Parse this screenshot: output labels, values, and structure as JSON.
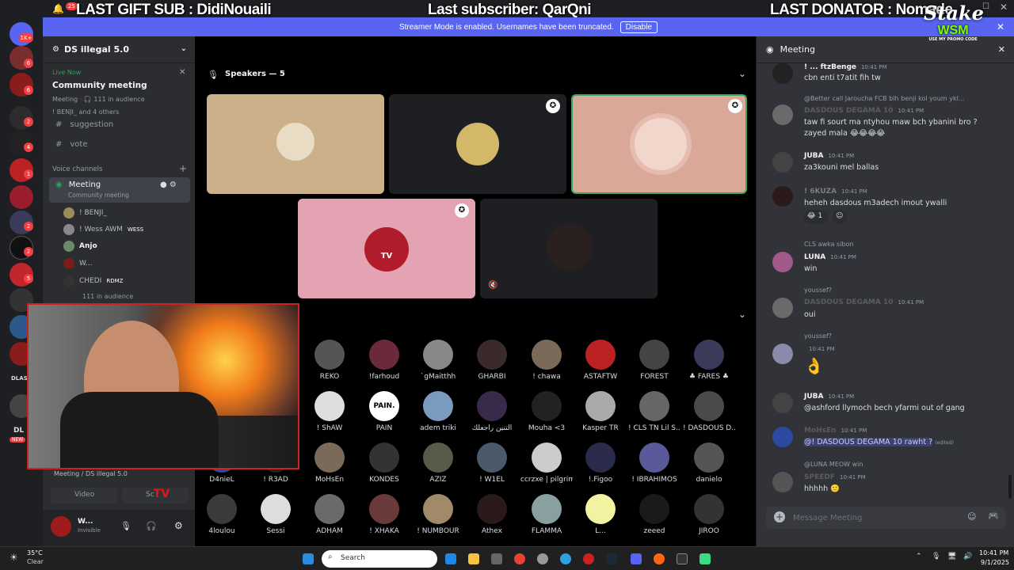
{
  "overlay": {
    "last_gift": "LAST GIFT SUB : DidiNouaili",
    "last_sub": "Last subscriber: QarQni",
    "last_donator": "LAST DONATOR : Nomade",
    "bell_count": "25",
    "stake_logo": "Stake",
    "wsm": "WSM",
    "promo": "USE MY PROMO CODE"
  },
  "streamer_bar": {
    "text": "Streamer Mode is enabled. Usernames have been truncated.",
    "disable": "Disable"
  },
  "rail": {
    "top_badge": "1K+",
    "badges": [
      "6",
      "6",
      "2",
      "4",
      "1",
      "2",
      "2",
      "5",
      "2"
    ],
    "dlas": "DLAS",
    "dl": "DL",
    "new": "NEW"
  },
  "sidebar": {
    "server_name": "DS illegal 5.0",
    "live_now": "Live Now",
    "event_title": "Community meeting",
    "event_meta": "Meeting · 🎧 111 in audience",
    "event_people": "! BENJI_ and 4 others",
    "channels": [
      "suggestion",
      "vote"
    ],
    "voice_header": "Voice channels",
    "voice_channel": "Meeting",
    "voice_sub": "Community meeting",
    "users": [
      {
        "name": "! BENJI_",
        "tag": ""
      },
      {
        "name": "! Wess AWM",
        "tag": "WESS"
      },
      {
        "name": "Anjo",
        "tag": ""
      },
      {
        "name": "W...",
        "tag": ""
      },
      {
        "name": "CHEDI",
        "tag": "RDMZ"
      }
    ],
    "audience": "111 in audience",
    "status_channel": "Meeting / DS illegal 5.0",
    "video_btn": "Video",
    "screen_btn": "Sc",
    "me_name": "W...",
    "me_status": "Invisible"
  },
  "stage": {
    "speakers_label": "Speakers — 5",
    "audience": [
      {
        "name": "REKO"
      },
      {
        "name": "!farhoud"
      },
      {
        "name": "`gMaitthh"
      },
      {
        "name": "GHARBI"
      },
      {
        "name": "! chawa"
      },
      {
        "name": "ASTAFTW"
      },
      {
        "name": "FOREST"
      },
      {
        "name": "♣ FARES ♣"
      },
      {
        "name": "! ShAW"
      },
      {
        "name": "PAIN"
      },
      {
        "name": "adem triki"
      },
      {
        "name": "التنين راجعلك"
      },
      {
        "name": "Mouha <3"
      },
      {
        "name": "Kasper TR"
      },
      {
        "name": "! CLS TN Lil S..."
      },
      {
        "name": "! DASDOUS D..."
      },
      {
        "name": "D4nieL"
      },
      {
        "name": "! R3AD"
      },
      {
        "name": "MoHsEn"
      },
      {
        "name": "KONDES"
      },
      {
        "name": "AZIZ"
      },
      {
        "name": "! W1EL"
      },
      {
        "name": "ccrzxe | pilgrim"
      },
      {
        "name": "!.Figoo"
      },
      {
        "name": "! IBRAHIMOS"
      },
      {
        "name": "danielo"
      },
      {
        "name": "4loulou"
      },
      {
        "name": "Sessi"
      },
      {
        "name": "ADHAM"
      },
      {
        "name": "! XHAKA"
      },
      {
        "name": "! NUMBOUR"
      },
      {
        "name": "Athex"
      },
      {
        "name": "FLAMMA"
      },
      {
        "name": "L..."
      },
      {
        "name": "zeeed"
      },
      {
        "name": "JIROO"
      }
    ],
    "pain_text": "PAIN.",
    "tv_logo": "TV"
  },
  "chat": {
    "title": "Meeting",
    "messages": [
      {
        "reply": "",
        "name": "! ... ftzBenge",
        "time": "10:41 PM",
        "text": "cbn enti t7atit fih tw"
      },
      {
        "reply": "@Better call Jaroucha  FCB  blh benji kol youm ykl...",
        "name": "DASDOUS DEGAMA 10",
        "time": "10:41 PM",
        "text": "taw fi sourt ma ntyhou maw bch ybanini bro ?"
      },
      {
        "reply": "",
        "name": "",
        "time": "",
        "text": "zayed mala 😂😂😂😂"
      },
      {
        "reply": "",
        "name": "JUBA",
        "time": "10:41 PM",
        "text": "za3kouni mel ballas"
      },
      {
        "reply": "",
        "name": "! 6KUZA",
        "time": "10:41 PM",
        "text": "heheh dasdous m3adech imout ywalli"
      },
      {
        "reply": "CLS  awka sibon",
        "name": "LUNA",
        "time": "10:41 PM",
        "text": "win"
      },
      {
        "reply": "youssef?",
        "name": "DASDOUS DEGAMA 10",
        "time": "10:41 PM",
        "text": "oui"
      },
      {
        "reply": "youssef?",
        "name": "",
        "time": "10:41 PM",
        "text": "👌"
      },
      {
        "reply": "",
        "name": "JUBA",
        "time": "10:41 PM",
        "text": "@ashford llymoch bech yfarmi out of gang"
      },
      {
        "reply": "",
        "name": "MoHsEn",
        "time": "10:41 PM",
        "text": "@! DASDOUS DEGAMA 10 rawht ?"
      },
      {
        "reply": "@LUNA  MEOW  win",
        "name": "SPEEDF",
        "time": "10:41 PM",
        "text": "hhhhh 🙂"
      }
    ],
    "edited": "(edited)",
    "reaction_count": "1",
    "input_placeholder": "Message Meeting"
  },
  "taskbar": {
    "weather_temp": "35°C",
    "weather_desc": "Clear",
    "search": "Search",
    "time": "10:41 PM",
    "date": "9/1/2025"
  }
}
